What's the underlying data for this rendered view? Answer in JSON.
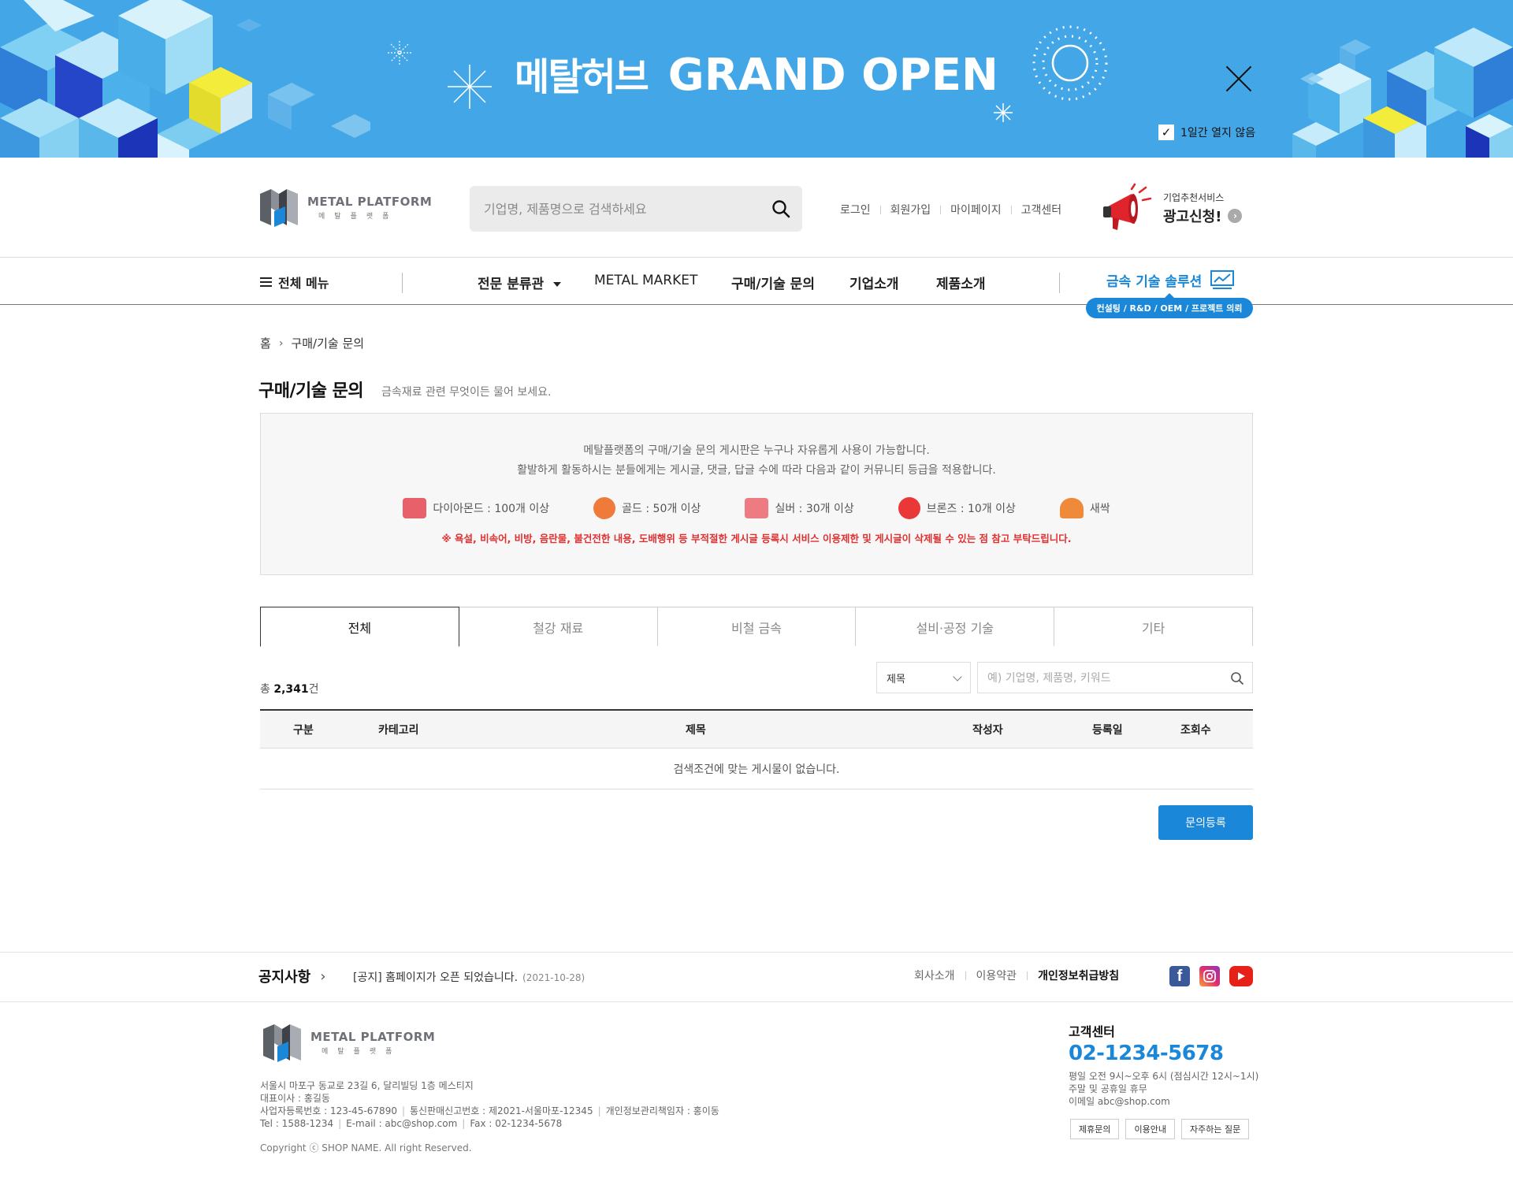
{
  "banner": {
    "title_ko": "메탈허브",
    "title_en": "GRAND OPEN",
    "noshow_label": "1일간 열지 않음",
    "bg_color": "#43a6e6"
  },
  "header": {
    "logo_title": "METAL PLATFORM",
    "logo_sub": "메탈플랫폼",
    "search_placeholder": "기업명, 제품명으로 검색하세요",
    "links": [
      "로그인",
      "회원가입",
      "마이페이지",
      "고객센터"
    ],
    "ad_sub": "기업추천서비스",
    "ad_main": "광고신청!"
  },
  "gnb": {
    "all_menu": "전체 메뉴",
    "items": [
      "전문 분류관",
      "METAL MARKET",
      "구매/기술 문의",
      "기업소개",
      "제품소개"
    ],
    "solution": "금속 기술 솔루션",
    "solution_badge": "컨설팅 / R&D / OEM / 프로젝트 의뢰",
    "accent": "#1a87d8"
  },
  "breadcrumb": {
    "home": "홈",
    "current": "구매/기술 문의"
  },
  "page": {
    "title": "구매/기술 문의",
    "desc": "금속재료 관련 무엇이든 물어 보세요."
  },
  "notice": {
    "line1": "메탈플랫폼의 구매/기술 문의 게시판은 누구나 자유롭게 사용이 가능합니다.",
    "line2": "활발하게 활동하시는 분들에게는 게시글, 댓글, 답글 수에 따라 다음과 같이 커뮤니티 등급을 적용합니다.",
    "grades": [
      {
        "label": "다이아몬드 : 100개 이상",
        "icon": "diamond-icon",
        "color": "#e8606a"
      },
      {
        "label": "골드 : 50개 이상",
        "icon": "gold-icon",
        "color": "#f07a3a"
      },
      {
        "label": "실버 : 30개 이상",
        "icon": "silver-icon",
        "color": "#ee7a82"
      },
      {
        "label": "브론즈 : 10개 이상",
        "icon": "bronze-icon",
        "color": "#ea3838"
      },
      {
        "label": "새싹",
        "icon": "sprout-icon",
        "color": "#ee8a3a"
      }
    ],
    "warning": "※ 욕설, 비속어, 비방, 음란물, 불건전한 내용, 도배행위 등 부적절한 게시글 등록시 서비스 이용제한 및 게시글이 삭제될 수 있는 점 참고 부탁드립니다.",
    "warning_color": "#e03030"
  },
  "tabs": [
    "전체",
    "철강 재료",
    "비철 금속",
    "설비·공정 기술",
    "기타"
  ],
  "filter": {
    "total_prefix": "총 ",
    "total_count": "2,341",
    "total_suffix": "건",
    "select_value": "제목",
    "keyword_placeholder": "예) 기업명, 제품명, 키워드"
  },
  "table": {
    "headers": [
      "구분",
      "카테고리",
      "제목",
      "작성자",
      "등록일",
      "조회수"
    ],
    "empty_text": "검색조건에 맞는 게시물이 없습니다."
  },
  "register_button": "문의등록",
  "footer": {
    "notice_label": "공지사항",
    "notice_text": "[공지] 홈페이지가 오픈 되었습니다.",
    "notice_date": "(2021-10-28)",
    "links": [
      "회사소개",
      "이용약관",
      "개인정보취급방침"
    ],
    "address": "서울시 마포구 동교로 23길 6, 달리빌딩 1층 메스티지",
    "ceo": "대표이사 : 홍길동",
    "biz_no": "사업자등록번호 : 123-45-67890",
    "mail_order_no": "통신판매신고번호 : 제2021-서울마포-12345",
    "privacy_officer": "개인정보관리책임자 : 홍이동",
    "tel": "Tel : 1588-1234",
    "email": "E-mail : abc@shop.com",
    "fax": "Fax : 02-1234-5678",
    "copyright": "Copyright ⓒ SHOP NAME. All right Reserved.",
    "cs_label": "고객센터",
    "cs_tel": "02-1234-5678",
    "cs_hours": "평일 오전 9시~오후 6시 (점심시간 12시~1시)",
    "cs_holiday": "주말 및 공휴일 휴무",
    "cs_email": "이메일 abc@shop.com",
    "cs_buttons": [
      "제휴문의",
      "이용안내",
      "자주하는 질문"
    ]
  }
}
